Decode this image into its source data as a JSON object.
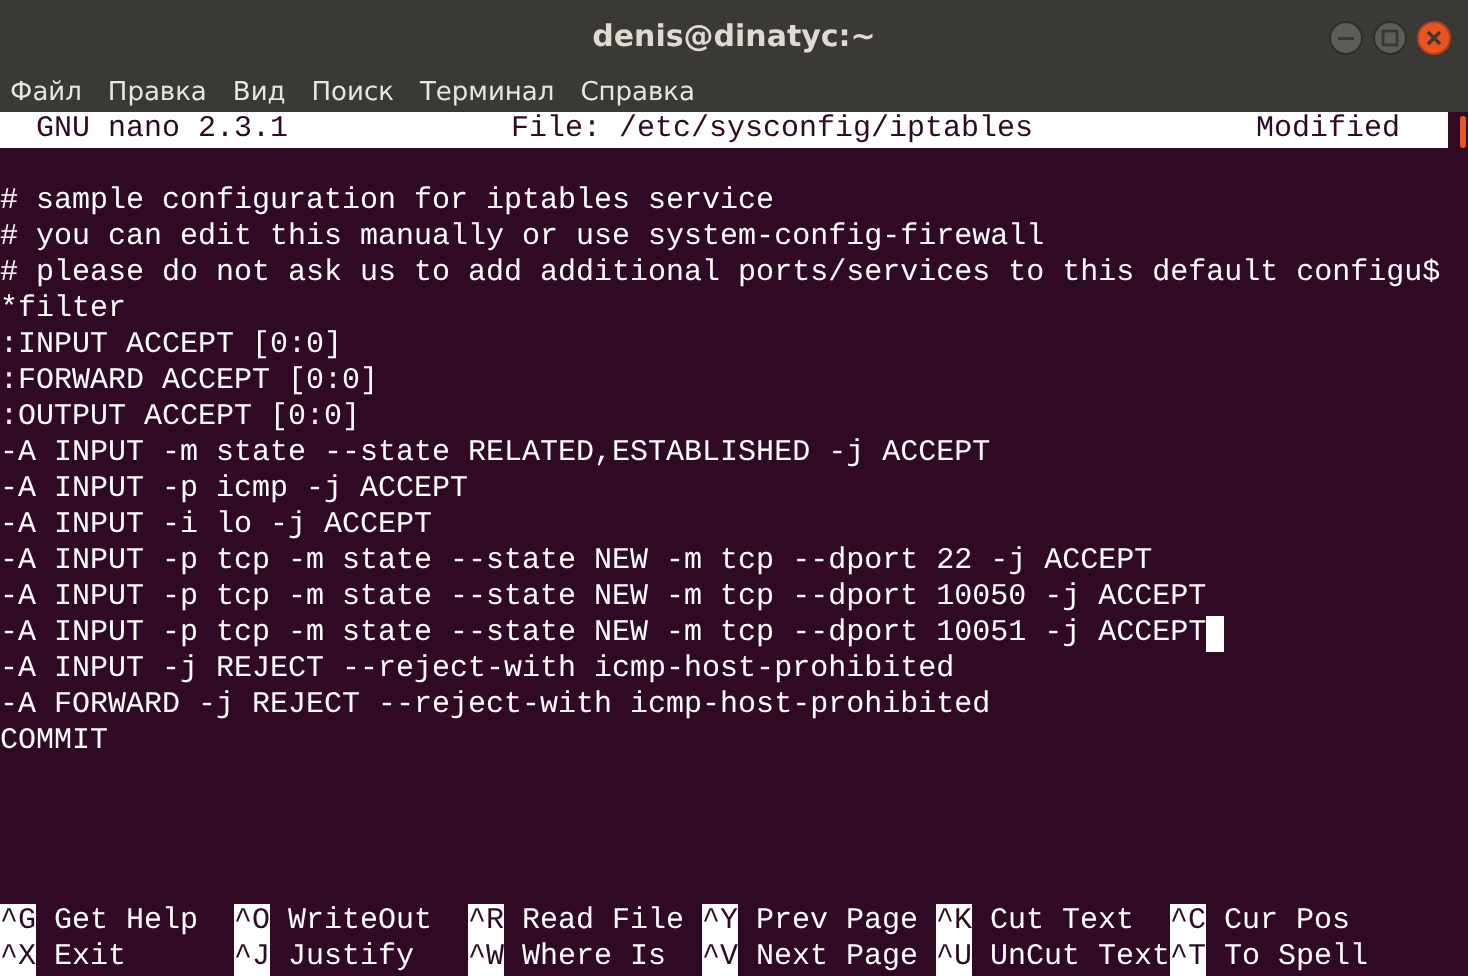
{
  "window": {
    "title": "denis@dinatyc:~"
  },
  "menu": [
    "Файл",
    "Правка",
    "Вид",
    "Поиск",
    "Терминал",
    "Справка"
  ],
  "nano_header": {
    "version": "GNU nano 2.3.1",
    "file": "File: /etc/sysconfig/iptables",
    "status": "Modified"
  },
  "lines": [
    {
      "text": "# sample configuration for iptables service",
      "cursor": false
    },
    {
      "text": "# you can edit this manually or use system-config-firewall",
      "cursor": false
    },
    {
      "text": "# please do not ask us to add additional ports/services to this default configu$",
      "cursor": false
    },
    {
      "text": "*filter",
      "cursor": false
    },
    {
      "text": ":INPUT ACCEPT [0:0]",
      "cursor": false
    },
    {
      "text": ":FORWARD ACCEPT [0:0]",
      "cursor": false
    },
    {
      "text": ":OUTPUT ACCEPT [0:0]",
      "cursor": false
    },
    {
      "text": "-A INPUT -m state --state RELATED,ESTABLISHED -j ACCEPT",
      "cursor": false
    },
    {
      "text": "-A INPUT -p icmp -j ACCEPT",
      "cursor": false
    },
    {
      "text": "-A INPUT -i lo -j ACCEPT",
      "cursor": false
    },
    {
      "text": "-A INPUT -p tcp -m state --state NEW -m tcp --dport 22 -j ACCEPT",
      "cursor": false
    },
    {
      "text": "-A INPUT -p tcp -m state --state NEW -m tcp --dport 10050 -j ACCEPT",
      "cursor": false
    },
    {
      "text": "-A INPUT -p tcp -m state --state NEW -m tcp --dport 10051 -j ACCEPT",
      "cursor": true
    },
    {
      "text": "-A INPUT -j REJECT --reject-with icmp-host-prohibited",
      "cursor": false
    },
    {
      "text": "-A FORWARD -j REJECT --reject-with icmp-host-prohibited",
      "cursor": false
    },
    {
      "text": "COMMIT",
      "cursor": false
    }
  ],
  "shortcuts": [
    [
      {
        "key": "^G",
        "label": "Get Help"
      },
      {
        "key": "^O",
        "label": "WriteOut"
      },
      {
        "key": "^R",
        "label": "Read File"
      },
      {
        "key": "^Y",
        "label": "Prev Page"
      },
      {
        "key": "^K",
        "label": "Cut Text"
      },
      {
        "key": "^C",
        "label": "Cur Pos"
      }
    ],
    [
      {
        "key": "^X",
        "label": "Exit"
      },
      {
        "key": "^J",
        "label": "Justify"
      },
      {
        "key": "^W",
        "label": "Where Is"
      },
      {
        "key": "^V",
        "label": "Next Page"
      },
      {
        "key": "^U",
        "label": "UnCut Text"
      },
      {
        "key": "^T",
        "label": "To Spell"
      }
    ]
  ]
}
